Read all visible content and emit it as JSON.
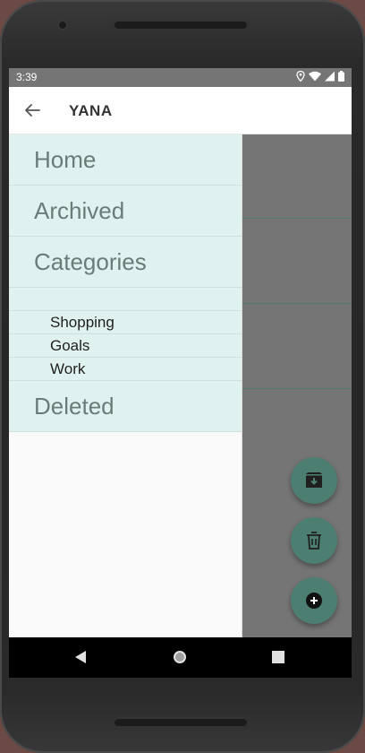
{
  "status_bar": {
    "time": "3:39",
    "icons": [
      "location-icon",
      "wifi-icon",
      "signal-icon",
      "battery-icon"
    ]
  },
  "app_bar": {
    "title": "YANA",
    "back_icon": "arrow-left-icon"
  },
  "drawer": {
    "items": [
      {
        "label": "Home"
      },
      {
        "label": "Archived"
      },
      {
        "label": "Categories"
      }
    ],
    "categories": [
      {
        "label": "Shopping"
      },
      {
        "label": "Goals"
      },
      {
        "label": "Work"
      }
    ],
    "deleted": {
      "label": "Deleted"
    }
  },
  "fabs": [
    {
      "icon": "archive-icon"
    },
    {
      "icon": "trash-icon"
    },
    {
      "icon": "add-circle-icon"
    }
  ],
  "nav_bar": {
    "icons": [
      "back-triangle-icon",
      "home-circle-icon",
      "recents-square-icon"
    ]
  },
  "colors": {
    "drawer_item_bg": "#e0f2ef",
    "fab_bg": "#4d7e72",
    "scrim": "#757575"
  }
}
